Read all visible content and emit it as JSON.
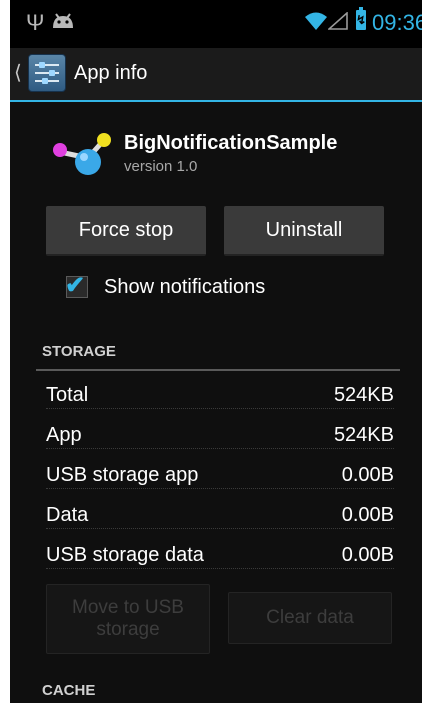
{
  "status_bar": {
    "time": "09:36",
    "icons": [
      "usb-icon",
      "android-icon",
      "wifi-icon",
      "signal-icon",
      "battery-charging-icon"
    ]
  },
  "action_bar": {
    "title": "App info",
    "icon": "settings-sliders-icon"
  },
  "app": {
    "name": "BigNotificationSample",
    "version": "version 1.0",
    "icon": "molecule-icon"
  },
  "buttons": {
    "force_stop": "Force stop",
    "uninstall": "Uninstall",
    "move_to_usb_line1": "Move to USB",
    "move_to_usb_line2": "storage",
    "clear_data": "Clear data"
  },
  "show_notifications": {
    "label": "Show notifications",
    "checked": true
  },
  "storage": {
    "header": "STORAGE",
    "rows": [
      {
        "label": "Total",
        "value": "524KB"
      },
      {
        "label": "App",
        "value": "524KB"
      },
      {
        "label": "USB storage app",
        "value": "0.00B"
      },
      {
        "label": "Data",
        "value": "0.00B"
      },
      {
        "label": "USB storage data",
        "value": "0.00B"
      }
    ]
  },
  "cache": {
    "header": "CACHE"
  },
  "colors": {
    "accent": "#33b5e5",
    "background": "#0f0f0f",
    "button": "#3a3a3a",
    "disabled_text": "#3d3d3d"
  }
}
